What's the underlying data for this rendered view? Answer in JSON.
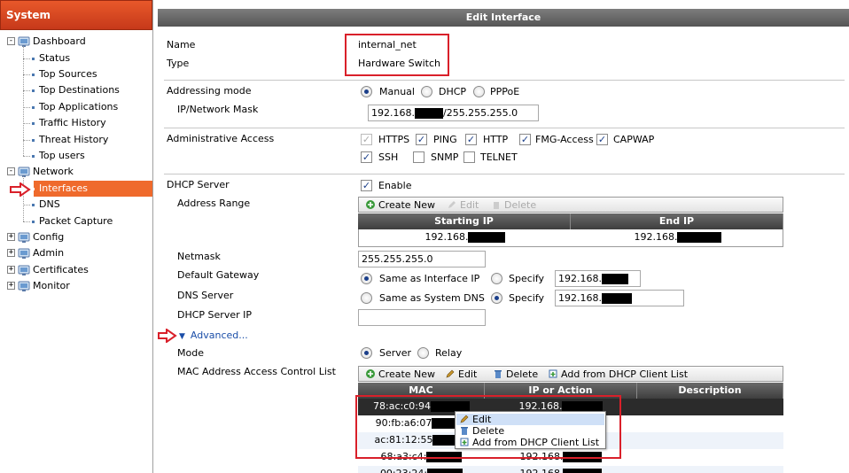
{
  "sidebar": {
    "title": "System",
    "items": [
      {
        "label": "Dashboard",
        "level": 0,
        "expander": "-"
      },
      {
        "label": "Status",
        "level": 1
      },
      {
        "label": "Top Sources",
        "level": 1
      },
      {
        "label": "Top Destinations",
        "level": 1
      },
      {
        "label": "Top Applications",
        "level": 1
      },
      {
        "label": "Traffic History",
        "level": 1
      },
      {
        "label": "Threat History",
        "level": 1
      },
      {
        "label": "Top users",
        "level": 1
      },
      {
        "label": "Network",
        "level": 0,
        "expander": "-"
      },
      {
        "label": "Interfaces",
        "level": 1,
        "selected": true
      },
      {
        "label": "DNS",
        "level": 1
      },
      {
        "label": "Packet Capture",
        "level": 1
      },
      {
        "label": "Config",
        "level": 0,
        "expander": "+"
      },
      {
        "label": "Admin",
        "level": 0,
        "expander": "+"
      },
      {
        "label": "Certificates",
        "level": 0,
        "expander": "+"
      },
      {
        "label": "Monitor",
        "level": 0,
        "expander": "+"
      }
    ]
  },
  "main": {
    "title": "Edit Interface",
    "name_label": "Name",
    "name_value": "internal_net",
    "type_label": "Type",
    "type_value": "Hardware Switch",
    "addressing_mode_label": "Addressing mode",
    "addressing_options": [
      "Manual",
      "DHCP",
      "PPPoE"
    ],
    "addressing_selected": "Manual",
    "ip_mask_label": "IP/Network Mask",
    "ip_prefix": "192.168.",
    "ip_suffix": "/255.255.255.0",
    "admin_access_label": "Administrative Access",
    "admin_access": [
      {
        "label": "HTTPS",
        "checked": true,
        "disabled": true
      },
      {
        "label": "PING",
        "checked": true
      },
      {
        "label": "HTTP",
        "checked": true
      },
      {
        "label": "FMG-Access",
        "checked": true
      },
      {
        "label": "CAPWAP",
        "checked": true
      },
      {
        "label": "SSH",
        "checked": true
      },
      {
        "label": "SNMP",
        "checked": false
      },
      {
        "label": "TELNET",
        "checked": false
      }
    ],
    "dhcp_server_label": "DHCP Server",
    "dhcp_enable_label": "Enable",
    "address_range_label": "Address Range",
    "range_toolbar": {
      "create": "Create New",
      "edit": "Edit",
      "delete": "Delete"
    },
    "range_columns": [
      "Starting IP",
      "End IP"
    ],
    "range_row": {
      "start": "192.168.",
      "end": "192.168."
    },
    "netmask_label": "Netmask",
    "netmask_value": "255.255.255.0",
    "gateway_label": "Default Gateway",
    "gateway_opt1": "Same as Interface IP",
    "gateway_opt2": "Specify",
    "gateway_value": "192.168.",
    "dns_label": "DNS Server",
    "dns_opt1": "Same as System DNS",
    "dns_opt2": "Specify",
    "dns_value": "192.168.",
    "dhcp_server_ip_label": "DHCP Server IP",
    "advanced_label": "Advanced...",
    "mode_label": "Mode",
    "mode_opt1": "Server",
    "mode_opt2": "Relay",
    "mac_acl_label": "MAC Address Access Control List",
    "mac_toolbar": {
      "create": "Create New",
      "edit": "Edit",
      "delete": "Delete",
      "add_dhcp": "Add from DHCP Client List"
    },
    "mac_columns": [
      "MAC",
      "IP or Action",
      "Description"
    ],
    "mac_rows": [
      {
        "mac": "78:ac:c0:94",
        "ip": "192.168."
      },
      {
        "mac": "90:fb:a6:07",
        "ip": ""
      },
      {
        "mac": "ac:81:12:55",
        "ip": ""
      },
      {
        "mac": "68:a3:c4:",
        "ip": "192.168."
      },
      {
        "mac": "00:23:24:",
        "ip": "192.168."
      }
    ],
    "context_menu": [
      "Edit",
      "Delete",
      "Add from DHCP Client List"
    ]
  },
  "colors": {
    "accent": "#ef6a2c",
    "highlight_red": "#d9202a",
    "header_dark": "#555555"
  }
}
